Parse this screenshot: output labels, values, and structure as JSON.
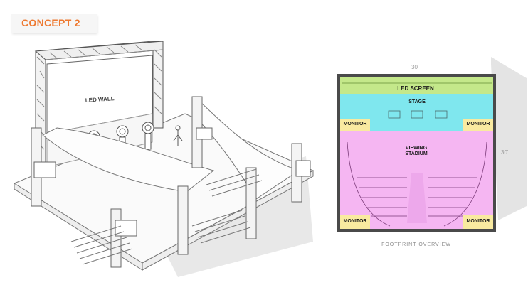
{
  "header": {
    "concept_label": "CONCEPT 2"
  },
  "sketch": {
    "wall_label": "LED WALL"
  },
  "plan": {
    "dimension_top": "30'",
    "dimension_right": "30'",
    "zones": {
      "led_screen": "LED SCREEN",
      "stage": "STAGE",
      "viewing_line1": "VIEWING",
      "viewing_line2": "STADIUM",
      "monitor_tl": "MONITOR",
      "monitor_tr": "MONITOR",
      "monitor_bl": "MONITOR",
      "monitor_br": "MONITOR"
    },
    "caption": "FOOTPRINT OVERVIEW",
    "colors": {
      "led_screen": "#c4e88a",
      "stage": "#7fe7ee",
      "viewing": "#f5b6f2",
      "monitor": "#f9eaa0",
      "border": "#4a4a4a"
    }
  }
}
